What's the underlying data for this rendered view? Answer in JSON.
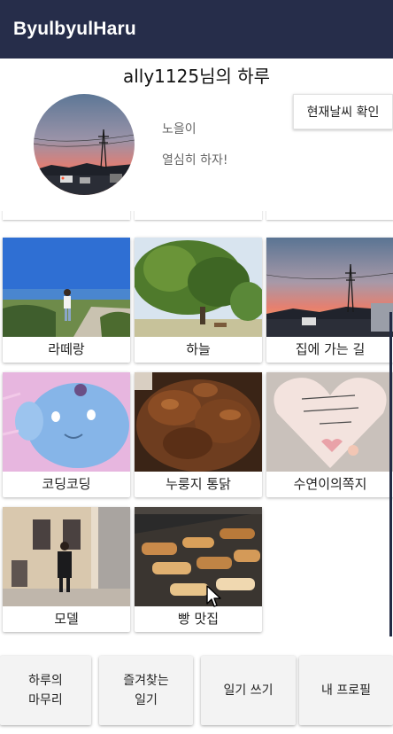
{
  "app": {
    "title": "ByulbyulHaru"
  },
  "profile": {
    "greeting": "ally1125님의 하루",
    "weather_button": "현재날씨 확인",
    "nickname": "노을이",
    "status": "열심히 하자!"
  },
  "diary": {
    "partial_labels": [
      "",
      "",
      ""
    ],
    "items": [
      {
        "label": "라떼랑",
        "image": "beach-walk-photo"
      },
      {
        "label": "하늘",
        "image": "tree-park-photo"
      },
      {
        "label": "집에 가는 길",
        "image": "sunset-road-photo"
      },
      {
        "label": "코딩코딩",
        "image": "cartoon-cat-photo"
      },
      {
        "label": "누룽지 통닭",
        "image": "roast-chicken-photo"
      },
      {
        "label": "수연이의쪽지",
        "image": "heart-note-photo"
      },
      {
        "label": "모델",
        "image": "street-model-photo"
      },
      {
        "label": "빵 맛집",
        "image": "bakery-display-photo"
      }
    ]
  },
  "bottom_nav": {
    "wrap_up": "하루의\n마무리",
    "favorites": "즐겨찾는\n일기",
    "write": "일기 쓰기",
    "my_profile": "내 프로필"
  },
  "colors": {
    "appbar": "#262d4a",
    "scrollbar": "#222b45"
  }
}
